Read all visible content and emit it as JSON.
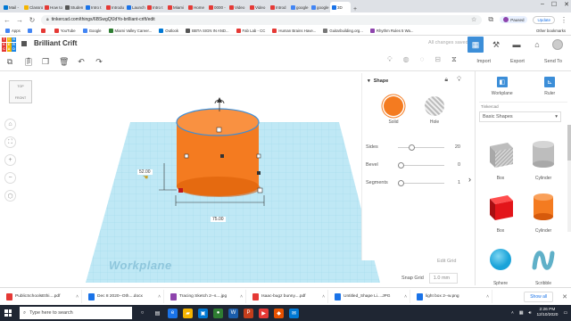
{
  "browser": {
    "tabs": [
      {
        "label": "Mail - ",
        "color": "#0078d4"
      },
      {
        "label": "Classro",
        "color": "#f4b400"
      },
      {
        "label": "How to",
        "color": "#e53935"
      },
      {
        "label": "Studen",
        "color": "#555555"
      },
      {
        "label": "Intro t",
        "color": "#1a73e8"
      },
      {
        "label": "Introdu",
        "color": "#e53935"
      },
      {
        "label": "Launch",
        "color": "#1a73e8"
      },
      {
        "label": "Intro t",
        "color": "#e53935"
      },
      {
        "label": "Miami",
        "color": "#e53935"
      },
      {
        "label": "Home",
        "color": "#e53935"
      },
      {
        "label": "0000 -",
        "color": "#e53935"
      },
      {
        "label": "Video",
        "color": "#e53935"
      },
      {
        "label": "Video",
        "color": "#e53935"
      },
      {
        "label": "Introd",
        "color": "#e53935"
      },
      {
        "label": "google",
        "color": "#4285f4"
      },
      {
        "label": "google",
        "color": "#4285f4"
      },
      {
        "label": "3D",
        "color": "#1a73e8",
        "active": true
      }
    ],
    "new_tab": "+",
    "url": "tinkercad.com/things/6BSwgQfJdYo-brilliant-crift/edit",
    "profile_label": "Paused",
    "update_label": "Update",
    "window_controls": [
      "–",
      "☐",
      "✕"
    ]
  },
  "bookmarks": {
    "items": [
      {
        "label": "Apps",
        "color": "#4285f4"
      },
      {
        "label": "",
        "color": "#4285f4"
      },
      {
        "label": "",
        "color": "#e53935"
      },
      {
        "label": "YouTube",
        "color": "#e53935"
      },
      {
        "label": "Google",
        "color": "#4285f4"
      },
      {
        "label": "Miami Valley Career...",
        "color": "#2e7d32"
      },
      {
        "label": "Outlook",
        "color": "#0078d4"
      },
      {
        "label": "BBTA SIGN IN AND...",
        "color": "#555555"
      },
      {
        "label": "Fab Lab - CC",
        "color": "#e53935"
      },
      {
        "label": "Human Brains Have...",
        "color": "#e53935"
      },
      {
        "label": "Guitarbuilding.org...",
        "color": "#777777"
      },
      {
        "label": "Rhythm Rules 5 Wa...",
        "color": "#8e44ad"
      }
    ],
    "other": "Other bookmarks"
  },
  "tinkercad": {
    "logo_letters": [
      "T",
      "I",
      "N",
      "K",
      "E",
      "R",
      "C",
      "A",
      "D"
    ],
    "logo_colors": [
      "#e53935",
      "#f4b400",
      "#1e88e5",
      "#e53935",
      "#f4b400",
      "#1e88e5",
      "#e53935",
      "#f4b400",
      "#1e88e5"
    ],
    "design_name": "Brilliant Crift",
    "save_status": "All changes saved",
    "actions": {
      "import": "Import",
      "export": "Export",
      "send_to": "Send To"
    }
  },
  "viewcube": {
    "top": "TOP",
    "front": "FRONT"
  },
  "scene": {
    "workplane_label": "Workplane",
    "width_dim": "75.00",
    "depth_dim": "52.00"
  },
  "shape_panel": {
    "title": "Shape",
    "solid_label": "Solid",
    "hole_label": "Hole",
    "params": [
      {
        "label": "Sides",
        "value": "20",
        "fraction": 0.25
      },
      {
        "label": "Bevel",
        "value": "0",
        "fraction": 0.0
      },
      {
        "label": "Segments",
        "value": "1",
        "fraction": 0.0
      }
    ],
    "edit_grid": "Edit Grid",
    "snap_label": "Snap Grid",
    "snap_value": "1.0 mm"
  },
  "library": {
    "workplane_label": "Workplane",
    "ruler_label": "Ruler",
    "category_label": "Tinkercad",
    "category_value": "Basic Shapes",
    "shapes": [
      {
        "label": "Box",
        "kind": "box-hole"
      },
      {
        "label": "Cylinder",
        "kind": "cyl-hole"
      },
      {
        "label": "Box",
        "kind": "box"
      },
      {
        "label": "Cylinder",
        "kind": "cyl"
      },
      {
        "label": "Sphere",
        "kind": "sphere"
      },
      {
        "label": "Scribble",
        "kind": "scribble"
      }
    ],
    "colors": {
      "box": "#e3151a",
      "cylinder": "#f47b20",
      "sphere": "#1aa3d9",
      "scribble": "#5fb0c8",
      "hole": "#bdbdbd"
    }
  },
  "downloads": {
    "items": [
      {
        "label": "PublicSchoolsEthi....pdf",
        "color": "#e53935"
      },
      {
        "label": "Dec 8 2020--Oth....docx",
        "color": "#1a73e8"
      },
      {
        "label": "Tracing Sketch 2--s....jpg",
        "color": "#8e44ad"
      },
      {
        "label": "Isaac-bugz bunny....pdf",
        "color": "#e53935"
      },
      {
        "label": "Untitled_Shape Li....JPG",
        "color": "#1a73e8"
      },
      {
        "label": "light box 2--w.png",
        "color": "#1a73e8"
      }
    ],
    "show_all": "Show all",
    "close": "✕"
  },
  "taskbar": {
    "search_placeholder": "Type here to search",
    "apps": [
      {
        "glyph": "○",
        "color": "#1f2633"
      },
      {
        "glyph": "▤",
        "color": "#1f2633"
      },
      {
        "glyph": "e",
        "color": "#1a73e8"
      },
      {
        "glyph": "▰",
        "color": "#f4b400"
      },
      {
        "glyph": "▣",
        "color": "#0078d4"
      },
      {
        "glyph": "●",
        "color": "#2e7d32"
      },
      {
        "glyph": "W",
        "color": "#1a5dab"
      },
      {
        "glyph": "P",
        "color": "#c43e1c"
      },
      {
        "glyph": "▶",
        "color": "#e53935"
      },
      {
        "glyph": "◆",
        "color": "#e65100"
      },
      {
        "glyph": "✉",
        "color": "#0078d4"
      }
    ],
    "time": "2:26 PM",
    "date": "12/10/2020"
  }
}
